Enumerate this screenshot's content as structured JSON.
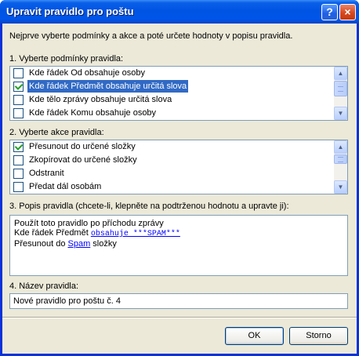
{
  "window": {
    "title": "Upravit pravidlo pro poštu",
    "help_glyph": "?",
    "close_glyph": "×"
  },
  "intro": "Nejprve vyberte podmínky a akce a poté určete hodnoty v popisu pravidla.",
  "section1": {
    "label": "1. Vyberte podmínky pravidla:",
    "items": [
      {
        "label": "Kde řádek Od obsahuje osoby",
        "checked": false,
        "selected": false
      },
      {
        "label": "Kde řádek Předmět obsahuje určitá slova",
        "checked": true,
        "selected": true
      },
      {
        "label": "Kde tělo zprávy obsahuje určitá slova",
        "checked": false,
        "selected": false
      },
      {
        "label": "Kde řádek Komu obsahuje osoby",
        "checked": false,
        "selected": false
      }
    ]
  },
  "section2": {
    "label": "2. Vyberte akce pravidla:",
    "items": [
      {
        "label": "Přesunout do určené složky",
        "checked": true,
        "selected": false
      },
      {
        "label": "Zkopírovat do určené složky",
        "checked": false,
        "selected": false
      },
      {
        "label": "Odstranit",
        "checked": false,
        "selected": false
      },
      {
        "label": "Předat dál osobám",
        "checked": false,
        "selected": false
      }
    ]
  },
  "section3": {
    "label": "3. Popis pravidla (chcete-li, klepněte na podtrženou hodnotu a upravte ji):",
    "line1": "Použít toto pravidlo po příchodu zprávy",
    "line2_prefix": "Kde řádek Předmět ",
    "line2_link": "obsahuje ***SPAM***",
    "line3_prefix": "Přesunout do ",
    "line3_link": "Spam",
    "line3_suffix": " složky"
  },
  "section4": {
    "label": "4. Název pravidla:",
    "value": "Nové pravidlo pro poštu č. 4"
  },
  "buttons": {
    "ok": "OK",
    "cancel": "Storno"
  }
}
